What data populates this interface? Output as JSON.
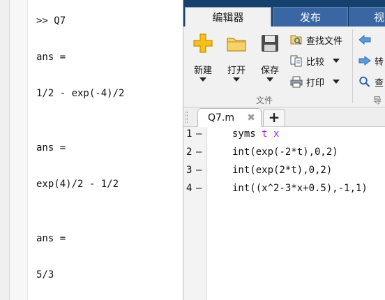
{
  "command_window": {
    "lines": [
      ">> Q7",
      "ans =",
      "1/2 - exp(-4)/2",
      "ans =",
      "exp(4)/2 - 1/2",
      "ans =",
      "5/3"
    ]
  },
  "editor": {
    "tabs": [
      "编辑器",
      "发布",
      "视"
    ],
    "toolstrip": {
      "new_label": "新建",
      "open_label": "打开",
      "save_label": "保存",
      "find_files_label": "查找文件",
      "compare_label": "比较",
      "print_label": "打印",
      "goto_label": "转",
      "find_label": "查",
      "file_section": "文件",
      "nav_section": "导"
    },
    "doc_tab": {
      "name": "Q7.m",
      "close": "✖",
      "add": "+"
    },
    "code_lines": [
      {
        "num": "1",
        "dash": "—",
        "kw": "syms",
        "rest_vars": " t x",
        "text": ""
      },
      {
        "num": "2",
        "dash": "—",
        "text": "int(exp(-2*t),0,2)"
      },
      {
        "num": "3",
        "dash": "—",
        "text": "int(exp(2*t),0,2)"
      },
      {
        "num": "4",
        "dash": "—",
        "text": "int((x^2-3*x+0.5),-1,1)"
      }
    ]
  },
  "colors": {
    "tabbar_bg": "#16406e",
    "active_tab_bg": "#f1f1f1",
    "inactive_tab_bg": "#3a67a3",
    "syms_var_color": "#a020f0"
  }
}
